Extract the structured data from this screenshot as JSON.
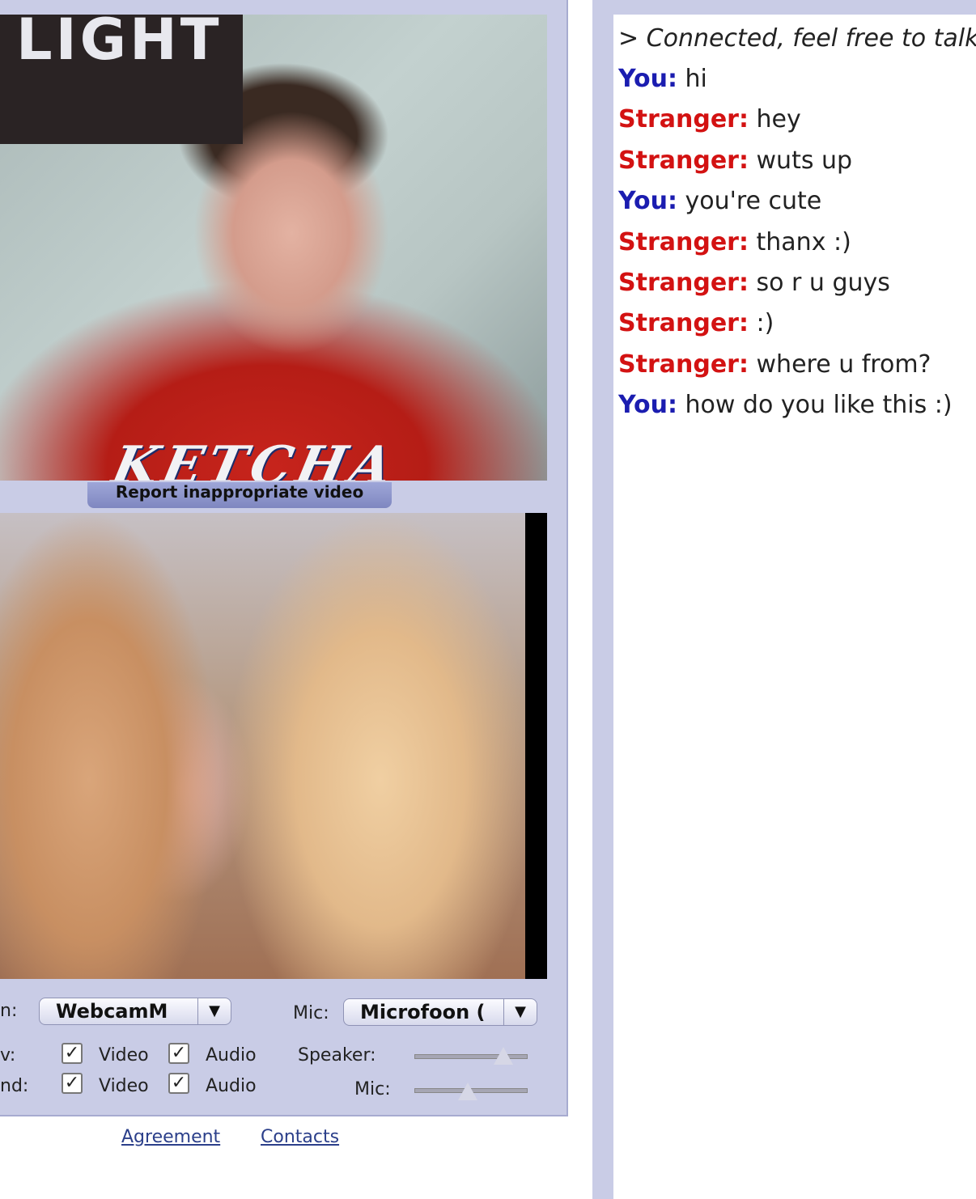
{
  "stranger_video": {
    "poster_text": "LIGHT",
    "shirt_text": "KETCHA",
    "report_label": "Report inappropriate video"
  },
  "controls": {
    "camera_label": "n:",
    "camera_value": "WebcamM",
    "mic_label": "Mic:",
    "mic_value": "Microfoon (",
    "view_label": "v:",
    "send_label": "nd:",
    "video_label": "Video",
    "audio_label": "Audio",
    "speaker_label": "Speaker:",
    "mic_level_label": "Mic:",
    "check_mark": "✓",
    "dropdown_arrow": "▼",
    "speaker_level": 0.8,
    "mic_level": 0.48
  },
  "footer": {
    "agreement": "Agreement",
    "contacts": "Contacts"
  },
  "chat": {
    "system": "> Connected, feel free to talk",
    "colors": {
      "you": "#1b1db0",
      "stranger": "#d31212"
    },
    "messages": [
      {
        "sender": "You:",
        "text": "hi"
      },
      {
        "sender": "Stranger:",
        "text": "hey"
      },
      {
        "sender": "Stranger:",
        "text": "wuts up"
      },
      {
        "sender": "You:",
        "text": "you're cute"
      },
      {
        "sender": "Stranger:",
        "text": "thanx :)"
      },
      {
        "sender": "Stranger:",
        "text": "so r u guys"
      },
      {
        "sender": "Stranger:",
        "text": ":)"
      },
      {
        "sender": "Stranger:",
        "text": "where u from?"
      },
      {
        "sender": "You:",
        "text": "how do you like this :)"
      }
    ]
  }
}
